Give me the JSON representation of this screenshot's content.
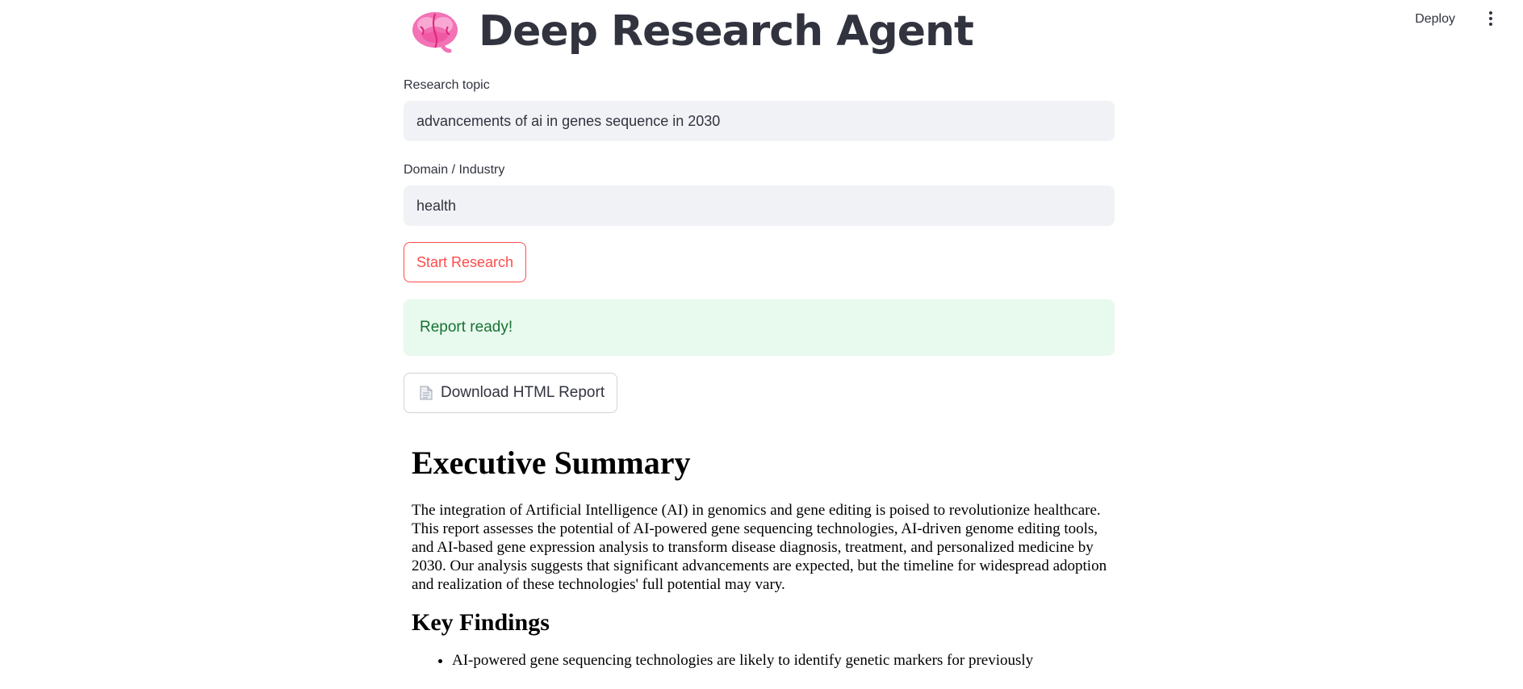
{
  "header": {
    "deploy_label": "Deploy",
    "menu_icon": "more-vertical-icon"
  },
  "app": {
    "title": "Deep Research Agent",
    "title_icon": "brain-emoji"
  },
  "form": {
    "topic_label": "Research topic",
    "topic_value": "advancements of ai in genes sequence in 2030",
    "domain_label": "Domain / Industry",
    "domain_value": "health",
    "start_button": "Start Research"
  },
  "status": {
    "message": "Report ready!"
  },
  "download": {
    "label": "Download HTML Report",
    "icon": "document-icon"
  },
  "report": {
    "h1": "Executive Summary",
    "summary": "The integration of Artificial Intelligence (AI) in genomics and gene editing is poised to revolutionize healthcare. This report assesses the potential of AI-powered gene sequencing technologies, AI-driven genome editing tools, and AI-based gene expression analysis to transform disease diagnosis, treatment, and personalized medicine by 2030. Our analysis suggests that significant advancements are expected, but the timeline for widespread adoption and realization of these technologies' full potential may vary.",
    "h2": "Key Findings",
    "findings": [
      "AI-powered gene sequencing technologies are likely to identify genetic markers for previously"
    ]
  },
  "colors": {
    "accent": "#ff4b4b",
    "success_bg": "#e8f9ee",
    "success_text": "#177233",
    "input_bg": "#f0f2f6",
    "text": "#31333f"
  }
}
